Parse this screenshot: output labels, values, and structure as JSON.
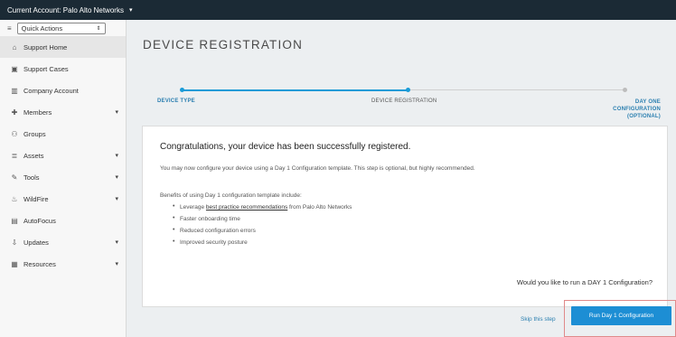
{
  "topbar": {
    "account_label": "Current Account: Palo Alto Networks",
    "caret": "▾"
  },
  "sidebar": {
    "quick_actions": {
      "icon": "menu-icon",
      "value": "Quick Actions",
      "arrows": "⇕"
    },
    "items": [
      {
        "label": "Support Home",
        "icon": "home-icon",
        "glyph": "⌂",
        "expandable": false,
        "active": true
      },
      {
        "label": "Support Cases",
        "icon": "briefcase-icon",
        "glyph": "▣",
        "expandable": false
      },
      {
        "label": "Company Account",
        "icon": "building-icon",
        "glyph": "▥",
        "expandable": false
      },
      {
        "label": "Members",
        "icon": "user-add-icon",
        "glyph": "✚",
        "expandable": true
      },
      {
        "label": "Groups",
        "icon": "group-icon",
        "glyph": "⚇",
        "expandable": false
      },
      {
        "label": "Assets",
        "icon": "assets-icon",
        "glyph": "≣",
        "expandable": true
      },
      {
        "label": "Tools",
        "icon": "wrench-icon",
        "glyph": "✎",
        "expandable": true
      },
      {
        "label": "WildFire",
        "icon": "flame-icon",
        "glyph": "♨",
        "expandable": true
      },
      {
        "label": "AutoFocus",
        "icon": "bar-chart-icon",
        "glyph": "▤",
        "expandable": false
      },
      {
        "label": "Updates",
        "icon": "download-icon",
        "glyph": "⇩",
        "expandable": true
      },
      {
        "label": "Resources",
        "icon": "chart-icon",
        "glyph": "▦",
        "expandable": true
      }
    ],
    "chevron": "▾"
  },
  "main": {
    "title": "DEVICE REGISTRATION",
    "steps": [
      {
        "label": "DEVICE TYPE",
        "state": "complete"
      },
      {
        "label": "DEVICE REGISTRATION",
        "state": "current"
      },
      {
        "label": "DAY ONE CONFIGURATION (OPTIONAL)",
        "state": "pending"
      }
    ],
    "card": {
      "heading": "Congratulations, your device has been successfully registered.",
      "paragraph": "You may now configure your device using a Day 1 Configuration template. This step is optional, but highly recommended.",
      "benefits_title": "Benefits of using Day 1 configuration template include:",
      "benefits": [
        {
          "prefix": "Leverage ",
          "link": "best practice recommendations",
          "suffix": " from Palo Alto Networks"
        },
        {
          "text": "Faster onboarding time"
        },
        {
          "text": "Reduced configuration errors"
        },
        {
          "text": "Improved security posture"
        }
      ],
      "question": "Would you like to run a DAY 1 Configuration?"
    },
    "skip_label": "Skip this step",
    "run_label": "Run Day 1 Configuration"
  },
  "colors": {
    "accent": "#1d8ed4",
    "topbar": "#1b2a35",
    "highlight": "#e08a8a"
  }
}
